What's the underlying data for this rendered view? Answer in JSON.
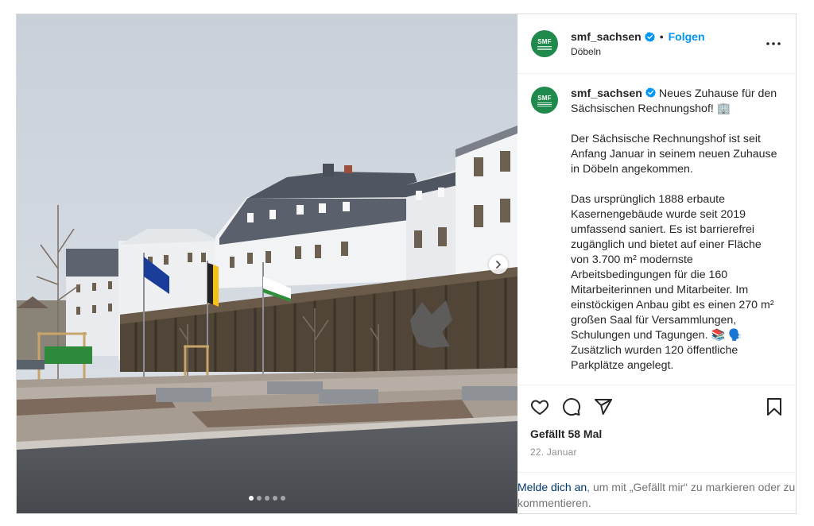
{
  "header": {
    "username": "smf_sachsen",
    "separator": "•",
    "follow_label": "Folgen",
    "location": "Döbeln",
    "avatar_text": "SMF"
  },
  "caption": {
    "username": "smf_sachsen",
    "line1": "Neues Zuhause für den Sächsischen Rechnungshof! 🏢",
    "para2": "Der Sächsische Rechnungshof ist seit Anfang Januar in seinem neuen Zuhause in Döbeln angekommen.",
    "para3": "Das ursprünglich 1888 erbaute Kasernengebäude wurde seit 2019 umfassend saniert. Es ist barrierefrei zugänglich und bietet auf einer Fläche von 3.700 m² modernste Arbeitsbedingungen für die 160 Mitarbeiterinnen und Mitarbeiter. Im einstöckigen Anbau gibt es einen 270 m² großen Saal für Versammlungen, Schulungen und Tagungen. 📚 🗣️ Zusätzlich wurden 120 öffentliche Parkplätze angelegt."
  },
  "engagement": {
    "likes": "Gefällt 58 Mal",
    "date": "22. Januar"
  },
  "login_prompt": {
    "link": "Melde dich an",
    "rest": ", um mit „Gefällt mir“ zu markieren oder zu kommentieren."
  },
  "carousel": {
    "total_slides": 5,
    "current_slide": 1
  },
  "colors": {
    "accent_blue": "#0095f6",
    "link_dark_blue": "#00376b",
    "brand_green": "#1f8a4c",
    "muted_gray": "#8e8e8e"
  },
  "icons": [
    "verified-badge-icon",
    "more-options-icon",
    "heart-icon",
    "comment-icon",
    "share-icon",
    "bookmark-icon",
    "chevron-right-icon"
  ]
}
